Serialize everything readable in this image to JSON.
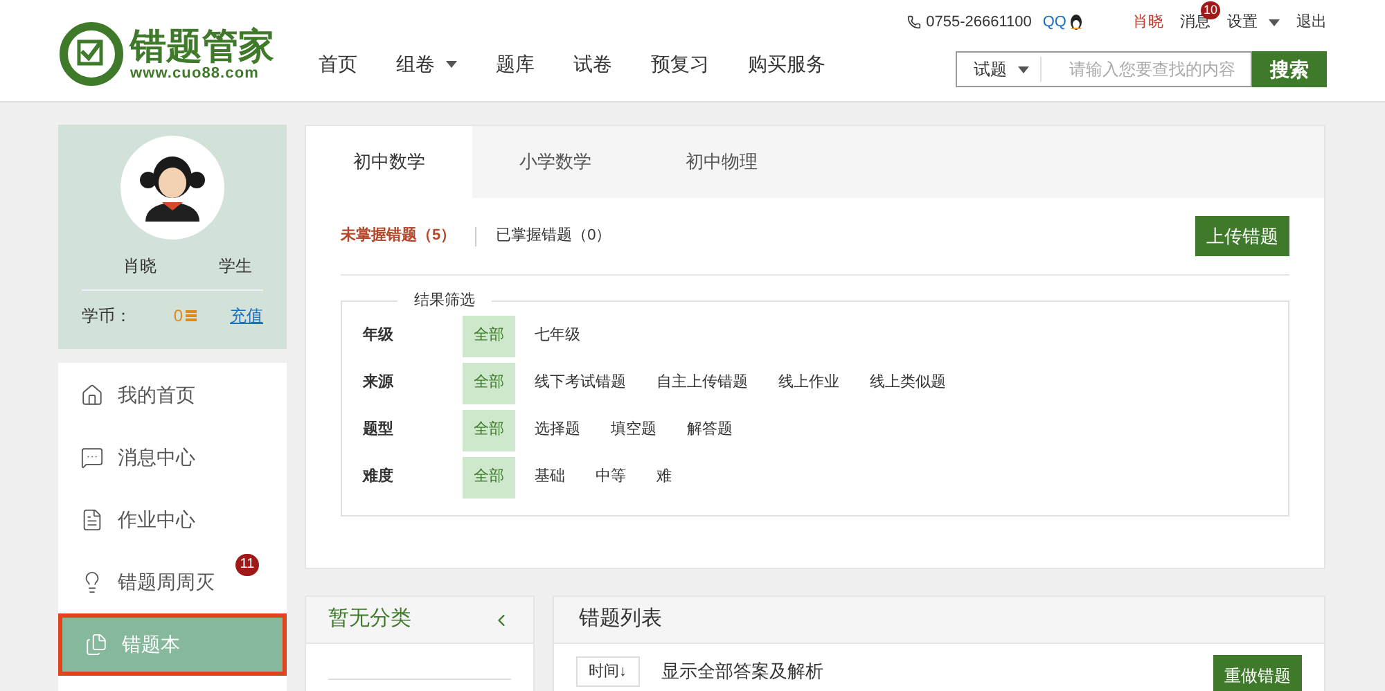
{
  "logo": {
    "name": "错题管家",
    "url": "www.cuo88.com"
  },
  "topbar": {
    "phone": "0755-26661100",
    "qq": "QQ",
    "user": "肖晓",
    "messages": "消息",
    "message_count": "10",
    "settings": "设置",
    "logout": "退出"
  },
  "nav": [
    {
      "label": "首页",
      "dropdown": false
    },
    {
      "label": "组卷",
      "dropdown": true
    },
    {
      "label": "题库",
      "dropdown": false
    },
    {
      "label": "试卷",
      "dropdown": false
    },
    {
      "label": "预复习",
      "dropdown": false
    },
    {
      "label": "购买服务",
      "dropdown": false
    }
  ],
  "search": {
    "scope": "试题",
    "placeholder": "请输入您要查找的内容",
    "button": "搜索"
  },
  "profile": {
    "name": "肖晓",
    "role": "学生",
    "coins_label": "学币：",
    "coins": "0",
    "recharge": "充值"
  },
  "sidebar": {
    "items": [
      {
        "label": "我的首页",
        "selected": false
      },
      {
        "label": "消息中心",
        "selected": false
      },
      {
        "label": "作业中心",
        "selected": false
      },
      {
        "label": "错题周周灭",
        "selected": false,
        "badge": "11"
      },
      {
        "label": "错题本",
        "selected": true
      }
    ]
  },
  "tabs": [
    {
      "label": "初中数学",
      "selected": true
    },
    {
      "label": "小学数学",
      "selected": false
    },
    {
      "label": "初中物理",
      "selected": false
    }
  ],
  "subtabs": [
    {
      "label": "未掌握错题（5）",
      "selected": true
    },
    {
      "label": "已掌握错题（0）",
      "selected": false
    }
  ],
  "upload_button": "上传错题",
  "filter": {
    "title": "结果筛选",
    "rows": [
      {
        "label": "年级",
        "options": [
          {
            "label": "全部",
            "selected": true
          },
          {
            "label": "七年级",
            "selected": false
          }
        ]
      },
      {
        "label": "来源",
        "options": [
          {
            "label": "全部",
            "selected": true
          },
          {
            "label": "线下考试错题",
            "selected": false
          },
          {
            "label": "自主上传错题",
            "selected": false
          },
          {
            "label": "线上作业",
            "selected": false
          },
          {
            "label": "线上类似题",
            "selected": false
          }
        ]
      },
      {
        "label": "题型",
        "options": [
          {
            "label": "全部",
            "selected": true
          },
          {
            "label": "选择题",
            "selected": false
          },
          {
            "label": "填空题",
            "selected": false
          },
          {
            "label": "解答题",
            "selected": false
          }
        ]
      },
      {
        "label": "难度",
        "options": [
          {
            "label": "全部",
            "selected": true
          },
          {
            "label": "基础",
            "selected": false
          },
          {
            "label": "中等",
            "selected": false
          },
          {
            "label": "难",
            "selected": false
          }
        ]
      }
    ]
  },
  "category_panel": {
    "title": "暂无分类"
  },
  "list_panel": {
    "title": "错题列表",
    "sort": "时间↓",
    "show_all": "显示全部答案及解析",
    "redo_button": "重做错题"
  }
}
